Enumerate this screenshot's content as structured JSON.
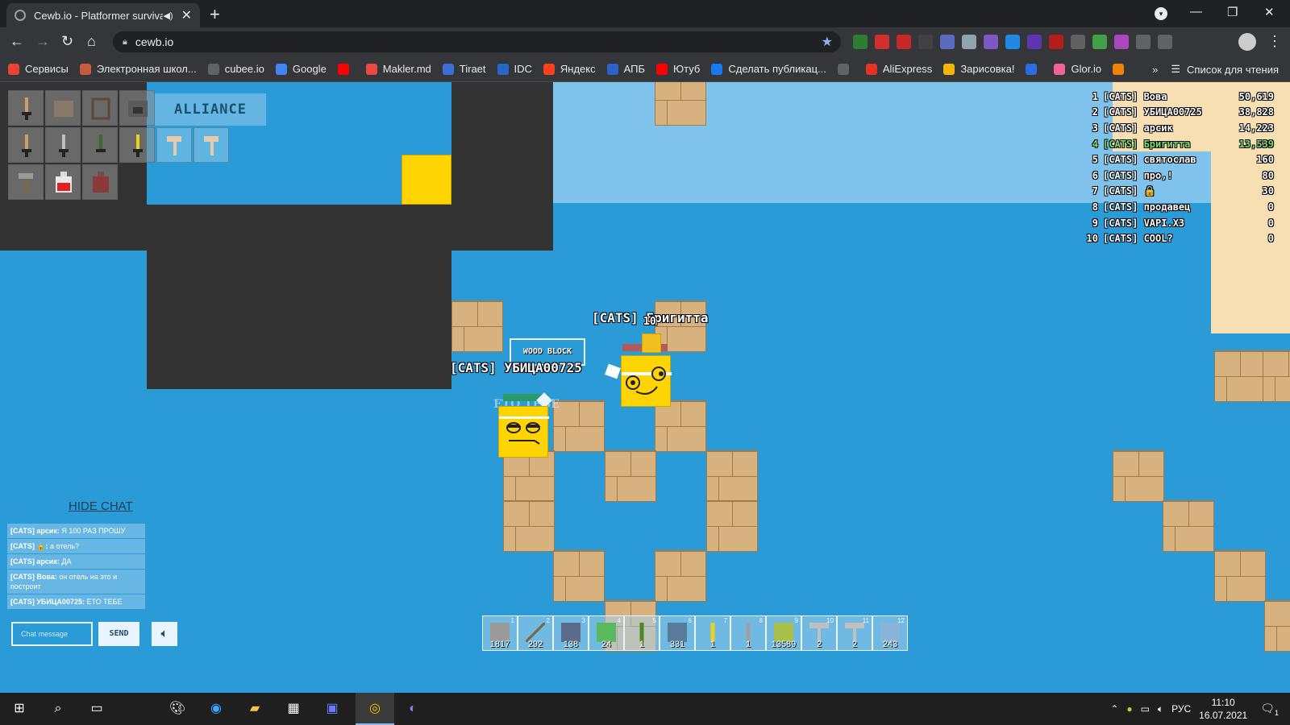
{
  "browser": {
    "tab_title": "Cewb.io - Platformer survival",
    "new_tab": "+",
    "url": "cewb.io",
    "bookmarks": [
      {
        "label": "Сервисы",
        "color": "#ea4335"
      },
      {
        "label": "Электронная школ...",
        "color": "#c75b3a"
      },
      {
        "label": "cubee.io",
        "color": "#5f6368"
      },
      {
        "label": "Google",
        "color": "#4285f4"
      },
      {
        "label": "",
        "color": "#ff0000"
      },
      {
        "label": "Makler.md",
        "color": "#e94a3f"
      },
      {
        "label": "Tiraet",
        "color": "#3b6fd8"
      },
      {
        "label": "IDC",
        "color": "#2b64c8"
      },
      {
        "label": "Яндекс",
        "color": "#fc3f1d"
      },
      {
        "label": "АПБ",
        "color": "#2a62c9"
      },
      {
        "label": "Ютуб",
        "color": "#ff0000"
      },
      {
        "label": "Сделать публикац...",
        "color": "#1877f2"
      },
      {
        "label": "",
        "color": "#5f6368"
      },
      {
        "label": "AliExpress",
        "color": "#e43225"
      },
      {
        "label": "Зарисовка!",
        "color": "#f2b705"
      },
      {
        "label": "",
        "color": "#2d6cdf"
      },
      {
        "label": "Glor.io",
        "color": "#f06292"
      },
      {
        "label": "",
        "color": "#ee8208"
      }
    ],
    "bookmarks_more": "»",
    "reading_list": "Список для чтения"
  },
  "game": {
    "alliance_label": "ALLIANCE",
    "tooltip": "WOOD BLOCK",
    "players": {
      "other_name": "[CATS] Бригитта",
      "other_level": "10",
      "self_name": "[CATS] УБИЦА00725",
      "self_speech": "ЕТО ТЕБЕ"
    },
    "leaderboard": [
      {
        "rank": "1",
        "name": "[CATS] Вова",
        "score": "50,619"
      },
      {
        "rank": "2",
        "name": "[CATS] УБИЦА00725",
        "score": "38,828"
      },
      {
        "rank": "3",
        "name": "[CATS] арсик",
        "score": "14,223"
      },
      {
        "rank": "4",
        "name": "[CATS] Бригитта",
        "score": "13,539"
      },
      {
        "rank": "5",
        "name": "[CATS] святослав",
        "score": "160"
      },
      {
        "rank": "6",
        "name": "[CATS] про,!",
        "score": "80"
      },
      {
        "rank": "7",
        "name": "[CATS] 🔒",
        "score": "30"
      },
      {
        "rank": "8",
        "name": "[CATS] продавец",
        "score": "0"
      },
      {
        "rank": "9",
        "name": "[CATS] VAPI.X3",
        "score": "0"
      },
      {
        "rank": "10",
        "name": "[CATS] COOL?",
        "score": "0"
      }
    ],
    "chat": {
      "hide_label": "HIDE CHAT",
      "messages": [
        {
          "from": "[CATS] арсик:",
          "text": "Я 100 РАЗ ПРОШУ"
        },
        {
          "from": "[CATS] 🔒:",
          "text": "а отель?"
        },
        {
          "from": "[CATS] арсик:",
          "text": "ДА"
        },
        {
          "from": "[CATS] Вова:",
          "text": "он отель на это и построит"
        },
        {
          "from": "[CATS] УБИЦА00725:",
          "text": "ЕТО ТЕБЕ"
        }
      ],
      "input_placeholder": "Chat message",
      "send_label": "SEND"
    },
    "hotbar": [
      {
        "num": "1",
        "count": "1817",
        "color": "#9a9a9a"
      },
      {
        "num": "2",
        "count": "292",
        "color": "#7a6a40"
      },
      {
        "num": "3",
        "count": "138",
        "color": "#5a6a8a"
      },
      {
        "num": "4",
        "count": "24",
        "color": "#5cb85c"
      },
      {
        "num": "5",
        "count": "1",
        "color": "#4a8a2a"
      },
      {
        "num": "6",
        "count": "331",
        "color": "#5a7a9a"
      },
      {
        "num": "7",
        "count": "1",
        "color": "#e8d21a"
      },
      {
        "num": "8",
        "count": "1",
        "color": "#a0a0a0"
      },
      {
        "num": "9",
        "count": "13589",
        "color": "#a8c04a"
      },
      {
        "num": "10",
        "count": "2",
        "color": "#c0c0c0"
      },
      {
        "num": "11",
        "count": "2",
        "color": "#c0c0c0"
      },
      {
        "num": "12",
        "count": "243",
        "color": "#8ab4d8"
      }
    ]
  },
  "taskbar": {
    "language": "РУС",
    "time": "11:10",
    "date": "16.07.2021",
    "notification_count": "1"
  }
}
